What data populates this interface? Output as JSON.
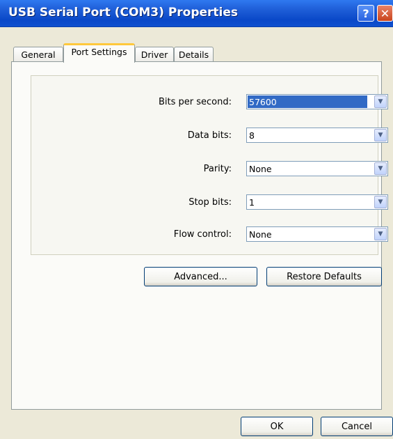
{
  "window": {
    "title": "USB Serial Port (COM3) Properties",
    "help_label": "?",
    "close_label": "✕"
  },
  "tabs": [
    {
      "label": "General",
      "selected": false
    },
    {
      "label": "Port Settings",
      "selected": true
    },
    {
      "label": "Driver",
      "selected": false
    },
    {
      "label": "Details",
      "selected": false
    }
  ],
  "port_settings": {
    "bits_per_second": {
      "label": "Bits per second:",
      "value": "57600"
    },
    "data_bits": {
      "label": "Data bits:",
      "value": "8"
    },
    "parity": {
      "label": "Parity:",
      "value": "None"
    },
    "stop_bits": {
      "label": "Stop bits:",
      "value": "1"
    },
    "flow_control": {
      "label": "Flow control:",
      "value": "None"
    }
  },
  "buttons": {
    "advanced": "Advanced...",
    "restore_defaults": "Restore Defaults",
    "ok": "OK",
    "cancel": "Cancel"
  },
  "icons": {
    "dropdown": "chevron-down-icon",
    "help": "help-icon",
    "close": "close-icon"
  },
  "colors": {
    "title_bar": "#0a48c8",
    "selection": "#316ac5",
    "tab_highlight": "#ffc83c",
    "close_button": "#c9441c"
  }
}
